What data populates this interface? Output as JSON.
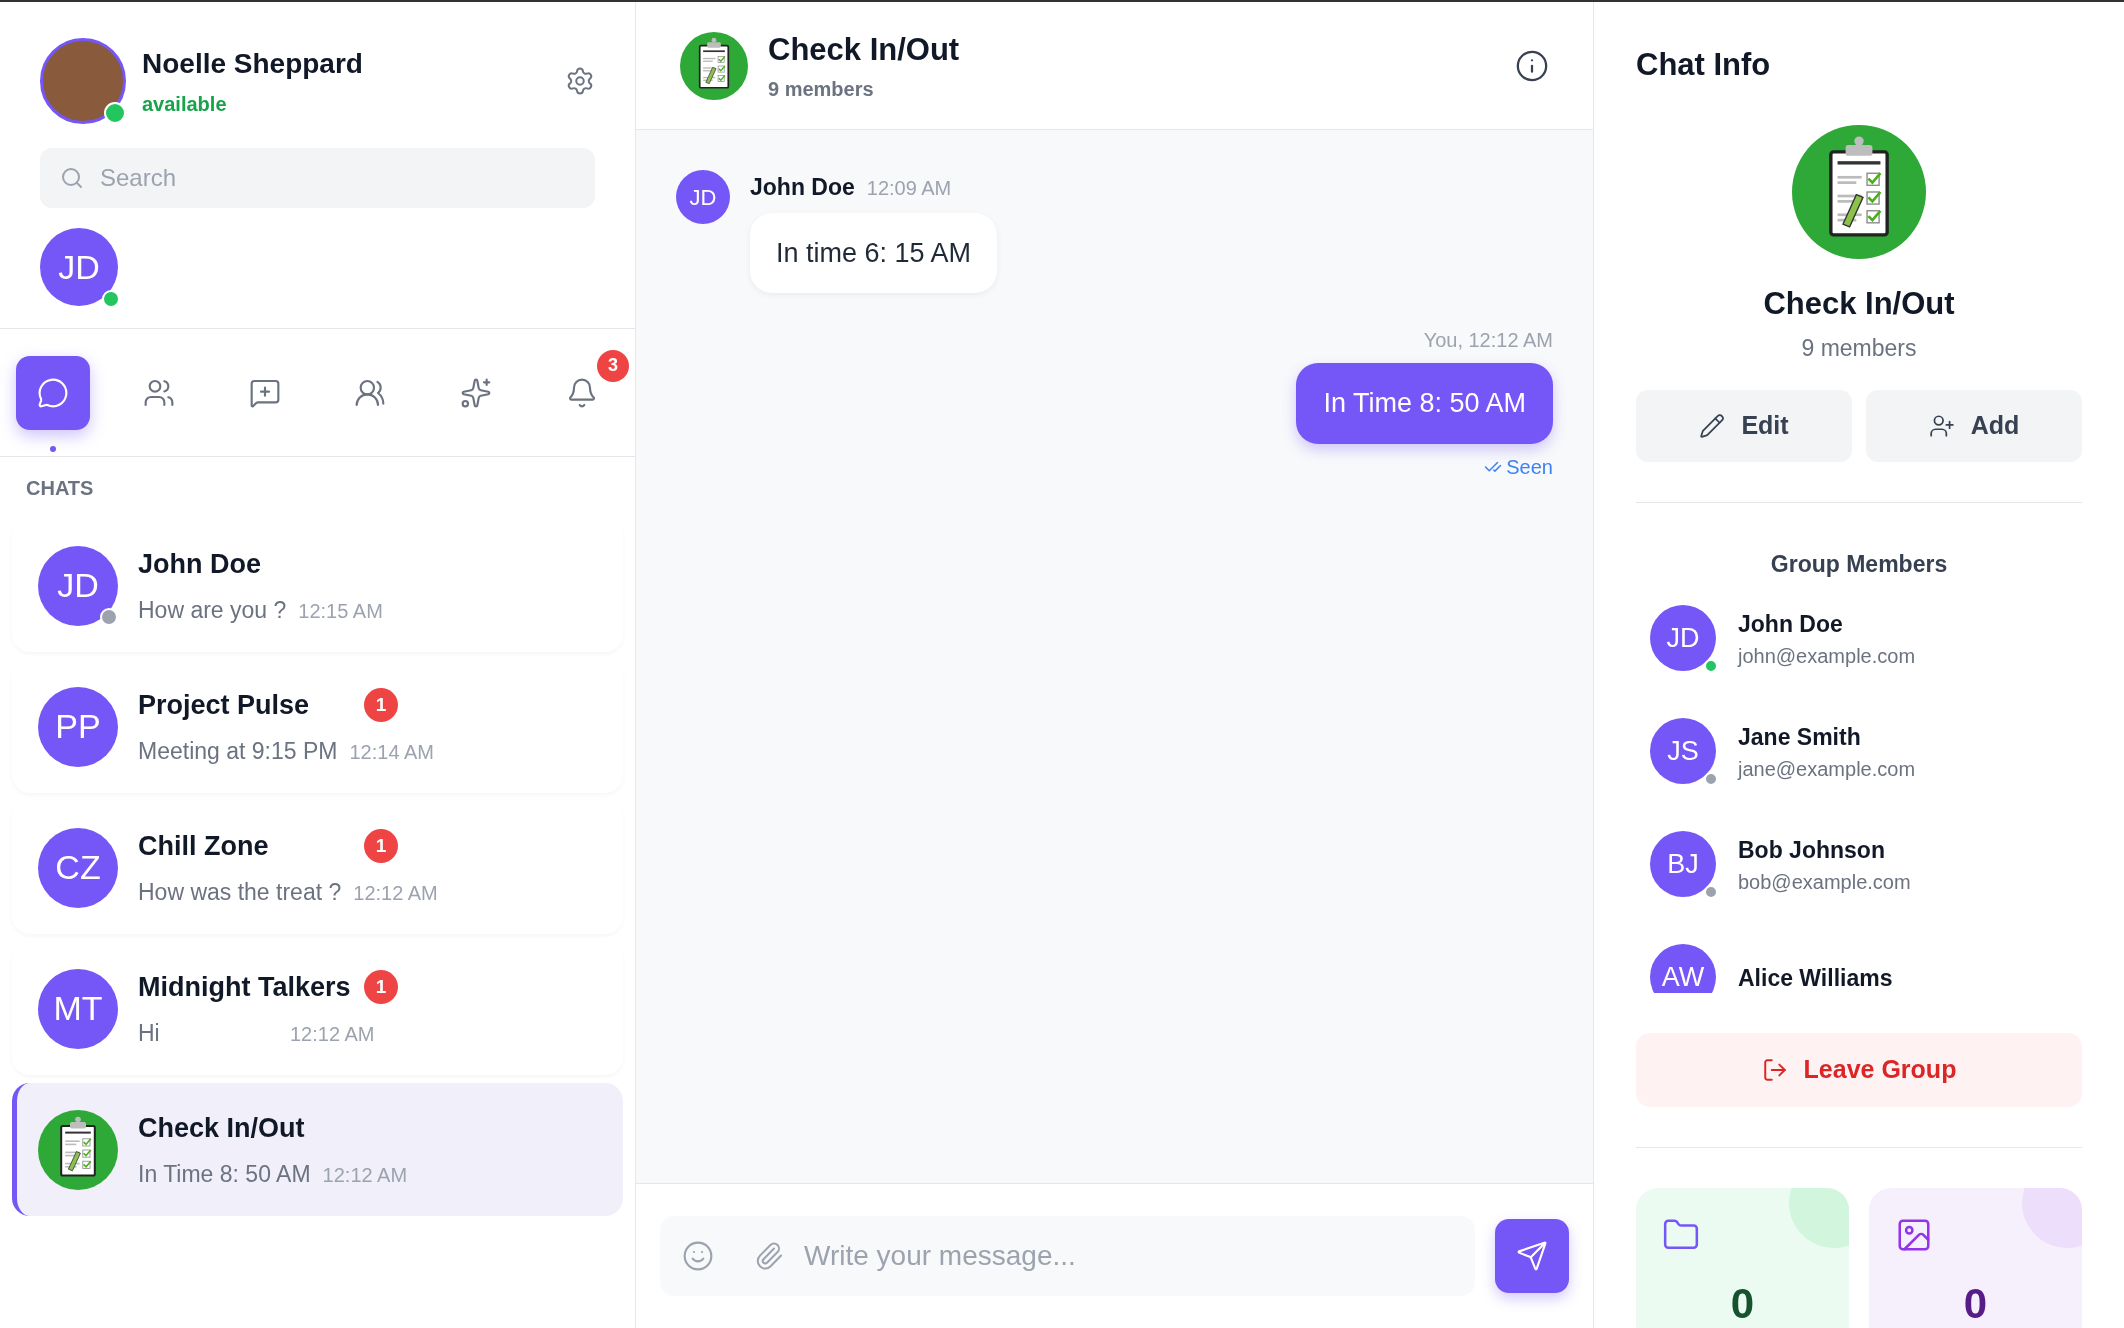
{
  "profile": {
    "name": "Noelle Sheppard",
    "status": "available",
    "online": true
  },
  "search": {
    "placeholder": "Search"
  },
  "online_users": [
    {
      "initials": "JD",
      "online": true
    }
  ],
  "nav_tabs": [
    {
      "kind": "chats",
      "selected": true
    },
    {
      "kind": "contacts",
      "selected": false
    },
    {
      "kind": "new-chat",
      "selected": false
    },
    {
      "kind": "groups",
      "selected": false
    },
    {
      "kind": "ai",
      "selected": false
    },
    {
      "kind": "notifications",
      "selected": false,
      "badge": "3"
    }
  ],
  "chats_heading": "CHATS",
  "chats": [
    {
      "kind": "initials",
      "initials": "JD",
      "name": "John Doe",
      "preview": "How are you ?",
      "time": "12:15 AM",
      "online": false,
      "selected": false
    },
    {
      "kind": "initials",
      "initials": "PP",
      "name": "Project Pulse",
      "preview": "Meeting at 9:15 PM",
      "time": "12:14 AM",
      "unread": "1",
      "selected": false
    },
    {
      "kind": "initials",
      "initials": "CZ",
      "name": "Chill Zone",
      "preview": "How was the treat ?",
      "time": "12:12 AM",
      "unread": "1",
      "selected": false
    },
    {
      "kind": "initials",
      "initials": "MT",
      "name": "Midnight Talkers",
      "preview": "Hi",
      "time": "12:12 AM",
      "unread": "1",
      "selected": false
    },
    {
      "kind": "picture",
      "name": "Check In/Out",
      "preview": "In Time 8: 50 AM",
      "time": "12:12 AM",
      "selected": true
    }
  ],
  "chat": {
    "title": "Check In/Out",
    "subtitle": "9 members"
  },
  "messages": [
    {
      "kind": "incoming",
      "initials": "JD",
      "sender": "John Doe",
      "time": "12:09 AM",
      "text": "In time 6: 15 AM"
    },
    {
      "kind": "outgoing",
      "meta": "You, 12:12 AM",
      "text": "In Time 8: 50 AM",
      "status": "Seen"
    }
  ],
  "composer": {
    "placeholder": "Write your message..."
  },
  "info": {
    "title": "Chat Info",
    "name": "Check In/Out",
    "subtitle": "9 members",
    "actions": [
      {
        "kind": "edit",
        "label": "Edit"
      },
      {
        "kind": "add",
        "label": "Add"
      }
    ],
    "members_heading": "Group Members",
    "members": [
      {
        "initials": "JD",
        "name": "John Doe",
        "email": "john@example.com",
        "online": true
      },
      {
        "initials": "JS",
        "name": "Jane Smith",
        "email": "jane@example.com",
        "online": false
      },
      {
        "initials": "BJ",
        "name": "Bob Johnson",
        "email": "bob@example.com",
        "online": false
      },
      {
        "initials": "AW",
        "name": "Alice Williams"
      }
    ],
    "leave_label": "Leave Group",
    "stats": [
      {
        "kind": "files",
        "count": "0"
      },
      {
        "kind": "photos",
        "count": "0"
      }
    ]
  }
}
